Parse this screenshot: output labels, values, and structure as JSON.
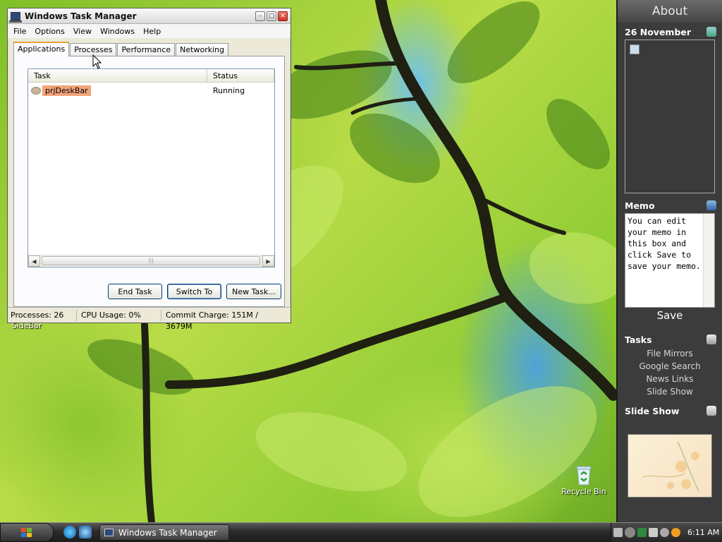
{
  "desktop": {
    "icons": [
      {
        "label": "SideBar"
      },
      {
        "label": "Recycle Bin"
      }
    ]
  },
  "task_manager": {
    "title": "Windows Task Manager",
    "menu": [
      "File",
      "Options",
      "View",
      "Windows",
      "Help"
    ],
    "tabs": [
      "Applications",
      "Processes",
      "Performance",
      "Networking"
    ],
    "active_tab": "Applications",
    "columns": [
      "Task",
      "Status"
    ],
    "rows": [
      {
        "task": "prjDeskBar",
        "status": "Running"
      }
    ],
    "buttons": {
      "end_task": "End Task",
      "switch_to": "Switch To",
      "new_task": "New Task..."
    },
    "status": {
      "processes": "Processes: 26",
      "cpu": "CPU Usage: 0%",
      "commit": "Commit Charge: 151M / 3679M"
    }
  },
  "sidebar": {
    "title": "About",
    "date": "26 November",
    "memo": {
      "title": "Memo",
      "text": "You can edit your memo in this box and click Save to save your memo.",
      "save_label": "Save"
    },
    "tasks": {
      "title": "Tasks",
      "items": [
        "File Mirrors",
        "Google Search",
        "News Links",
        "Slide Show"
      ]
    },
    "slideshow": {
      "title": "Slide Show"
    }
  },
  "taskbar": {
    "window_button": "Windows Task Manager",
    "clock": "6:11 AM"
  },
  "colors": {
    "sidebar_bg": "#3c3c3c",
    "selection": "#f2a47a",
    "active_tab_accent": "#e6a23c"
  }
}
